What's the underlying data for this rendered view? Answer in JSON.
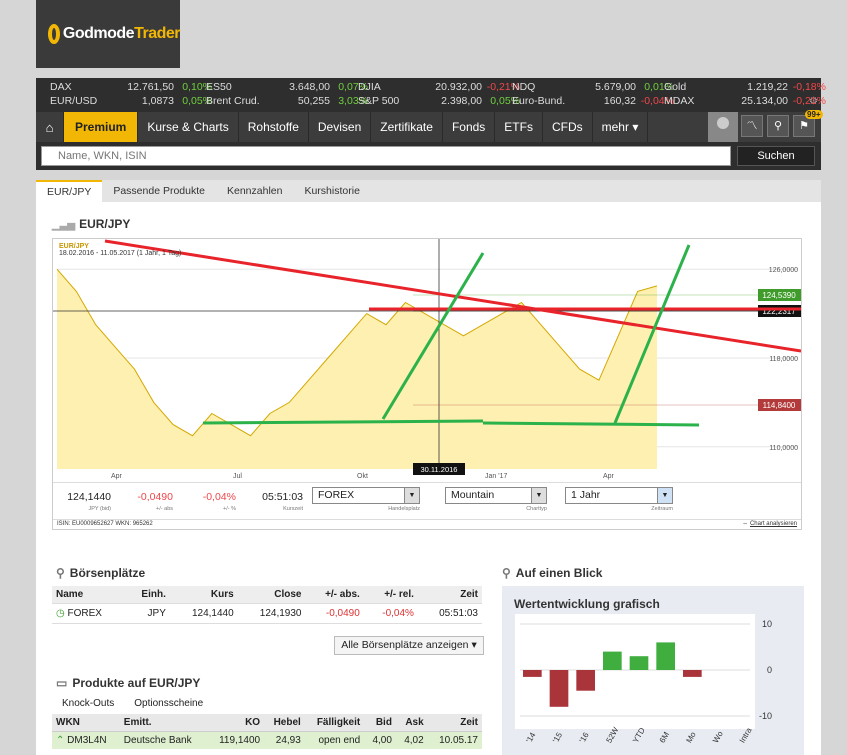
{
  "logo": {
    "part1": "Godmode",
    "part2": "Trader"
  },
  "ticker": [
    [
      {
        "n": "DAX",
        "v": "12.761,50",
        "c": "0,10%",
        "dir": "up"
      },
      {
        "n": "EUR/USD",
        "v": "1,0873",
        "c": "0,05%",
        "dir": "up"
      }
    ],
    [
      {
        "n": "ES50",
        "v": "3.648,00",
        "c": "0,07%",
        "dir": "up"
      },
      {
        "n": "Brent Crud...",
        "v": "50,255",
        "c": "3,03%",
        "dir": "up"
      }
    ],
    [
      {
        "n": "DJIA",
        "v": "20.932,00",
        "c": "-0,21%",
        "dir": "dn"
      },
      {
        "n": "S&P 500",
        "v": "2.398,00",
        "c": "0,05%",
        "dir": "up"
      }
    ],
    [
      {
        "n": "NDQ",
        "v": "5.679,00",
        "c": "0,01%",
        "dir": "up"
      },
      {
        "n": "Euro-Bund...",
        "v": "160,32",
        "c": "-0,04%",
        "dir": "dn"
      }
    ],
    [
      {
        "n": "Gold",
        "v": "1.219,22",
        "c": "-0,18%",
        "dir": "dn"
      },
      {
        "n": "MDAX",
        "v": "25.134,00",
        "c": "-0,21%",
        "dir": "dn"
      }
    ]
  ],
  "nav": {
    "items": [
      "Premium",
      "Kurse & Charts",
      "Rohstoffe",
      "Devisen",
      "Zertifikate",
      "Fonds",
      "ETFs",
      "CFDs",
      "mehr"
    ],
    "badge": "99+"
  },
  "search": {
    "placeholder": "Name, WKN, ISIN",
    "button": "Suchen"
  },
  "tabs": [
    "EUR/JPY",
    "Passende Produkte",
    "Kennzahlen",
    "Kurshistorie"
  ],
  "title": "EUR/JPY",
  "chart_data": {
    "type": "area",
    "symbol": "EUR/JPY",
    "period": "18.02.2016 - 11.05.2017",
    "x_labels": [
      "Apr",
      "Jul",
      "Okt",
      "Jan '17",
      "Apr"
    ],
    "y_ticks": [
      "126,0000",
      "118,0000",
      "110,0000"
    ],
    "markers": [
      {
        "label": "124,5390",
        "color": "#3f9c2a"
      },
      {
        "label": "122,2317",
        "color": "#111111"
      },
      {
        "label": "114,8400",
        "color": "#b23a3a"
      }
    ],
    "crosshair_date": "30.11.2016",
    "series": [
      {
        "values": [
          126,
          124,
          121,
          119,
          117,
          114,
          112,
          111,
          113,
          112,
          111,
          113,
          114,
          116,
          118,
          120,
          122,
          121,
          123,
          122,
          121,
          120,
          121,
          122,
          123,
          121,
          119,
          117,
          116,
          120,
          124,
          124.5
        ]
      }
    ],
    "ylim": [
      108,
      128
    ]
  },
  "chartinfo": {
    "symbol": "EUR/JPY",
    "range": "18.02.2016 - 11.05.2017  (1 Jahr, 1 Tag)"
  },
  "ctrl": {
    "kurs": "124,1440",
    "kurs_lbl": "JPY (bid)",
    "abs": "-0,0490",
    "abs_lbl": "+/- abs",
    "rel": "-0,04%",
    "rel_lbl": "+/- %",
    "zeit": "05:51:03",
    "zeit_lbl": "Kurszeit",
    "platz": "FOREX",
    "platz_lbl": "Handelsplatz",
    "typ": "Mountain",
    "typ_lbl": "Charttyp",
    "raum": "1 Jahr",
    "raum_lbl": "Zeitraum",
    "isin": "ISIN: EU0009652627 WKN: 965262",
    "link": "Chart analysieren"
  },
  "boersen": {
    "title": "Börsenplätze",
    "headers": [
      "Name",
      "Einh.",
      "Kurs",
      "Close",
      "+/- abs.",
      "+/- rel.",
      "Zeit"
    ],
    "row": [
      "FOREX",
      "JPY",
      "124,1440",
      "124,1930",
      "-0,0490",
      "-0,04%",
      "05:51:03"
    ],
    "button": "Alle Börsenplätze anzeigen"
  },
  "produkte": {
    "title": "Produkte auf EUR/JPY",
    "subtabs": [
      "Knock-Outs",
      "Optionsscheine"
    ],
    "headers": [
      "WKN",
      "Emitt.",
      "KO",
      "Hebel",
      "Fälligkeit",
      "Bid",
      "Ask",
      "Zeit"
    ],
    "row": [
      "DM3L4N",
      "Deutsche Bank",
      "119,1400",
      "24,93",
      "open end",
      "4,00",
      "4,02",
      "10.05.17"
    ]
  },
  "blick": {
    "title": "Auf einen Blick",
    "subtitle": "Wertentwicklung grafisch",
    "chart_data": {
      "type": "bar",
      "categories": [
        "'14",
        "'15",
        "'16",
        "52W",
        "YTD",
        "6M",
        "Mo",
        "Wo",
        "Intra"
      ],
      "values": [
        -1.5,
        -8,
        -4.5,
        4,
        3,
        6,
        -1.5,
        0,
        0
      ],
      "ylim": [
        -10,
        10
      ],
      "y_ticks": [
        "10",
        "0",
        "-10"
      ]
    }
  }
}
